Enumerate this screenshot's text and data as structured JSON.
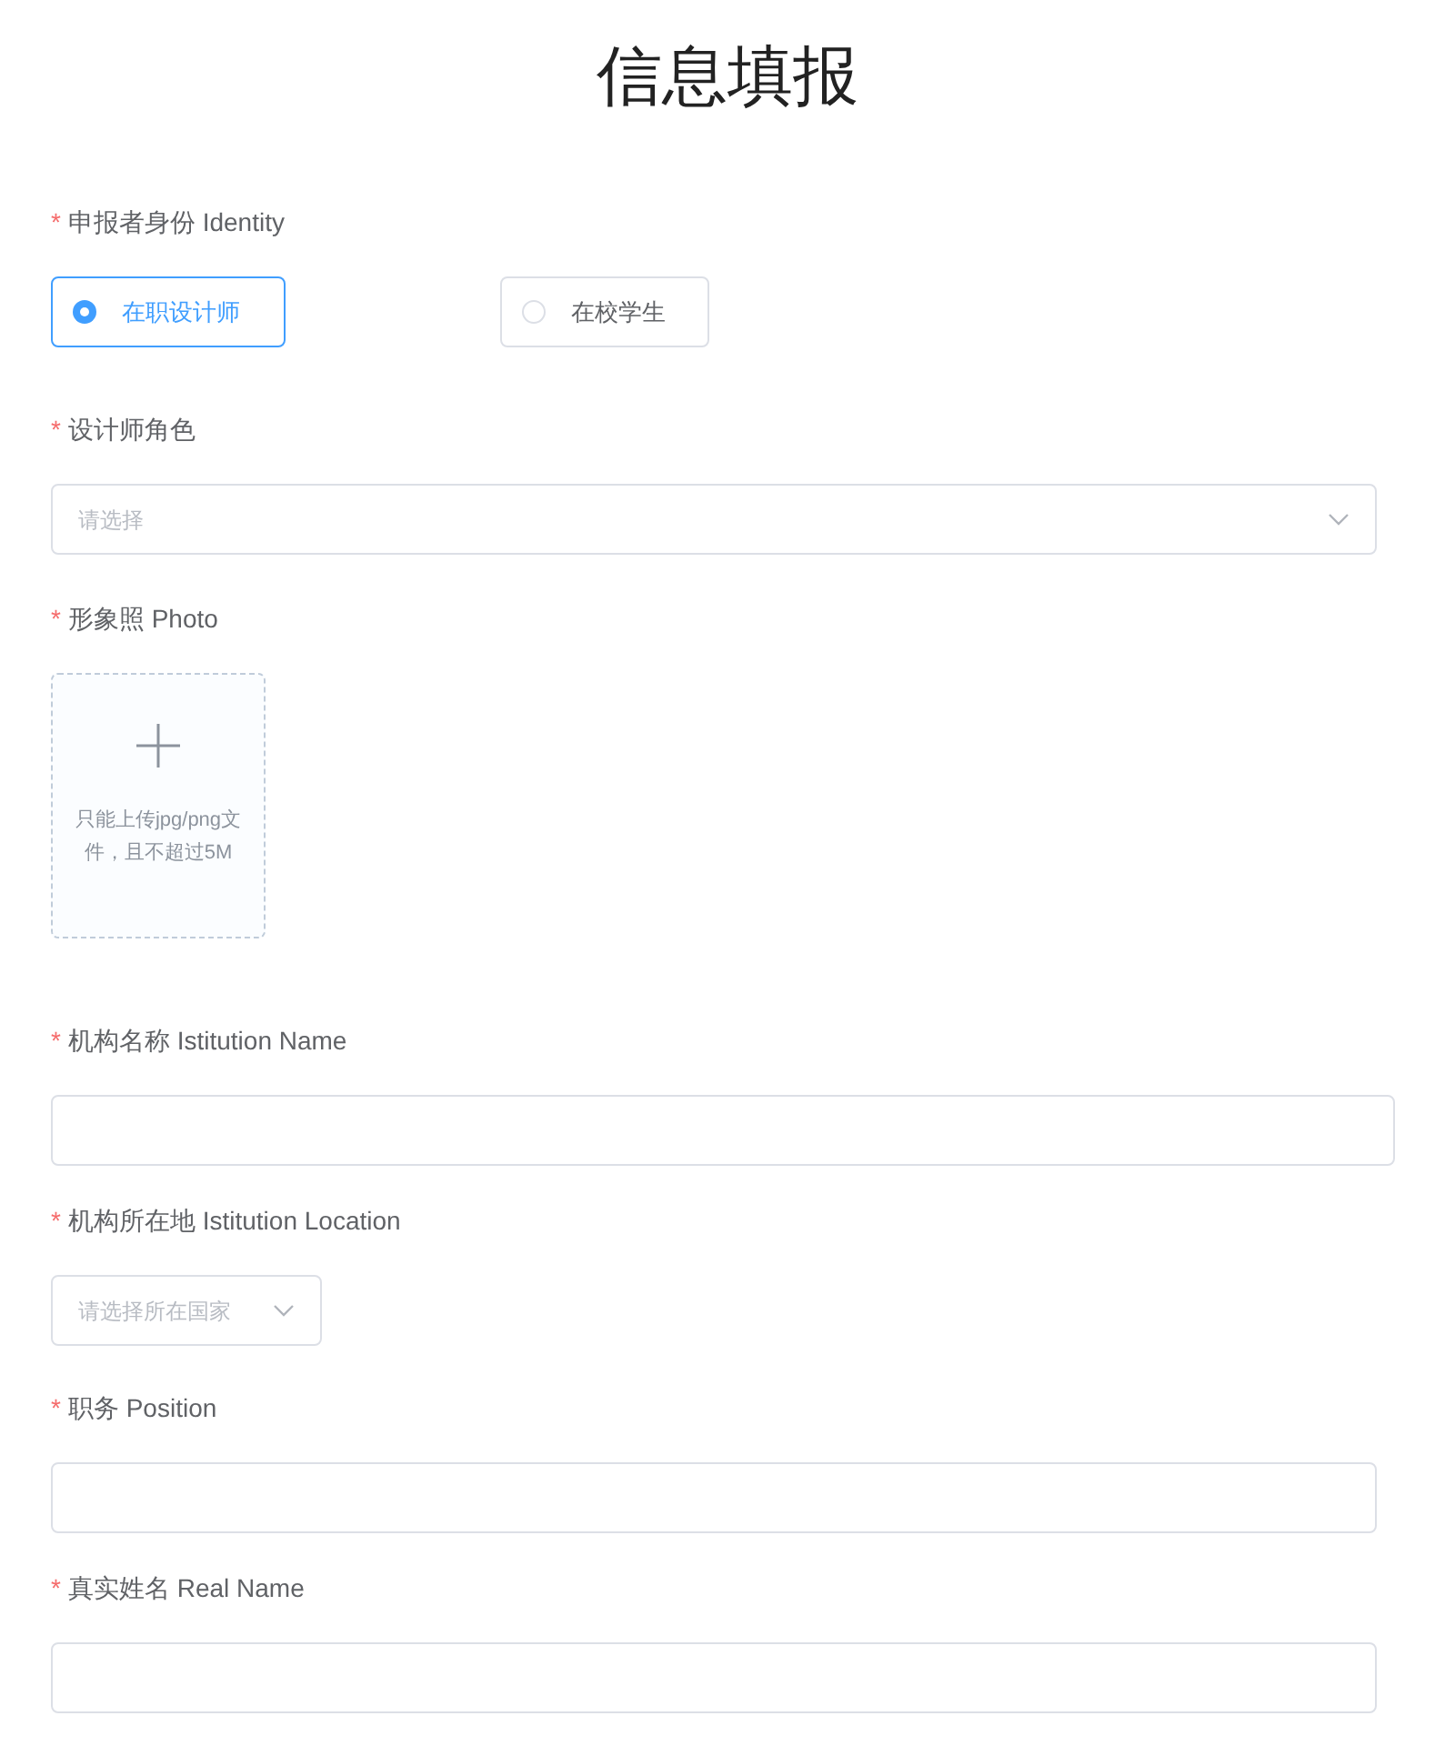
{
  "title": "信息填报",
  "fields": [
    {
      "kind": "radio",
      "mark": "*",
      "label": "申报者身份 Identity",
      "options": [
        {
          "label": "在职设计师",
          "selected": true
        },
        {
          "label": "在校学生",
          "selected": false
        }
      ]
    },
    {
      "kind": "select",
      "mark": "*",
      "label": "设计师角色",
      "placeholder": "请选择"
    },
    {
      "kind": "upload",
      "mark": "*",
      "label": "形象照 Photo",
      "hint": "只能上传jpg/png文件，且不超过5M"
    },
    {
      "kind": "text-wide",
      "mark": "*",
      "label": "机构名称 Istitution Name"
    },
    {
      "kind": "select-small",
      "mark": "*",
      "label": "机构所在地 Istitution Location",
      "placeholder": "请选择所在国家"
    },
    {
      "kind": "text",
      "mark": "*",
      "label": "职务 Position"
    },
    {
      "kind": "text",
      "mark": "*",
      "label": "真实姓名 Real Name"
    }
  ]
}
